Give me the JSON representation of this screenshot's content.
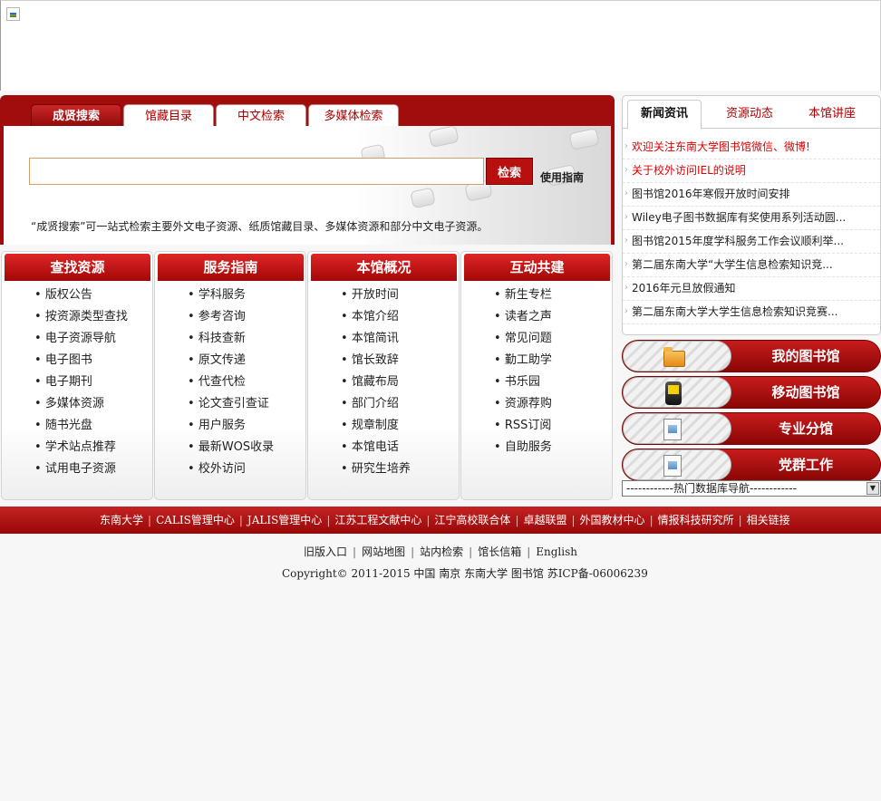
{
  "search": {
    "tabs": [
      "成贤搜索",
      "馆藏目录",
      "中文检索",
      "多媒体检索"
    ],
    "input_value": "",
    "button_label": "检索",
    "guide_label": "使用指南",
    "description": "“成贤搜索”可一站式检索主要外文电子资源、纸质馆藏目录、多媒体资源和部分中文电子资源。"
  },
  "news": {
    "tabs": [
      "新闻资讯",
      "资源动态",
      "本馆讲座"
    ],
    "items": [
      "欢迎关注东南大学图书馆微信、微博!",
      "关于校外访问IEL的说明",
      "图书馆2016年寒假开放时间安排",
      "Wiley电子图书数据库有奖使用系列活动圆...",
      "图书馆2015年度学科服务工作会议顺利举...",
      "第二届东南大学“大学生信息检索知识竞...",
      "2016年元旦放假通知",
      "第二届东南大学大学生信息检索知识竞赛..."
    ]
  },
  "side_buttons": [
    "我的图书馆",
    "移动图书馆",
    "专业分馆",
    "党群工作"
  ],
  "db_select": "------------热门数据库导航------------",
  "columns": [
    {
      "title": "查找资源",
      "items": [
        "版权公告",
        "按资源类型查找",
        "电子资源导航",
        "电子图书",
        "电子期刊",
        "多媒体资源",
        "随书光盘",
        "学术站点推荐",
        "试用电子资源"
      ]
    },
    {
      "title": "服务指南",
      "items": [
        "学科服务",
        "参考咨询",
        "科技查新",
        "原文传递",
        "代查代检",
        "论文查引查证",
        "用户服务",
        "最新WOS收录",
        "校外访问"
      ]
    },
    {
      "title": "本馆概况",
      "items": [
        "开放时间",
        "本馆介绍",
        "本馆简讯",
        "馆长致辞",
        "馆藏布局",
        "部门介绍",
        "规章制度",
        "本馆电话",
        "研究生培养"
      ]
    },
    {
      "title": "互动共建",
      "items": [
        "新生专栏",
        "读者之声",
        "常见问题",
        "勤工助学",
        "书乐园",
        "资源荐购",
        "RSS订阅",
        "自助服务"
      ]
    }
  ],
  "footer_links": [
    "东南大学",
    "CALIS管理中心",
    "JALIS管理中心",
    "江苏工程文献中心",
    "江宁高校联合体",
    "卓越联盟",
    "外国教材中心",
    "情报科技研究所",
    "相关链接"
  ],
  "bottom_links": [
    "旧版入口",
    "网站地图",
    "站内检索",
    "馆长信箱",
    "English"
  ],
  "copyright": "Copyright© 2011-2015 中国  南京  东南大学  图书馆  苏ICP备-06006239",
  "colors": {
    "brand_red": "#a10c0c",
    "hot_news": "#dd0000"
  }
}
